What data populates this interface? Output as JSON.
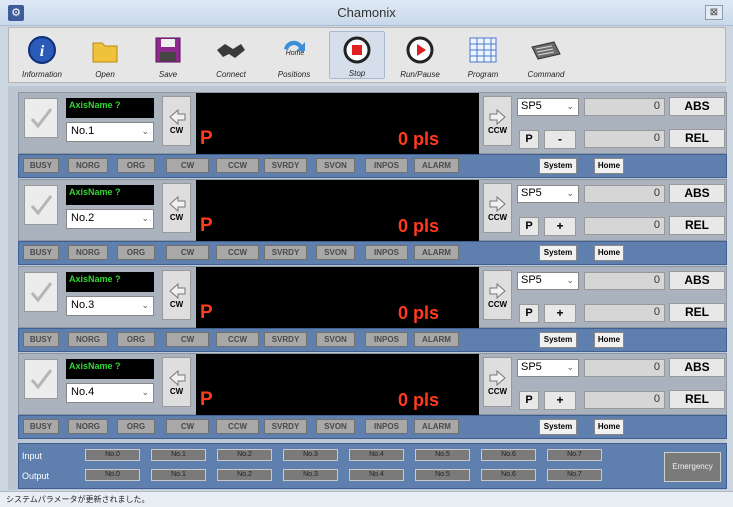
{
  "window": {
    "title": "Chamonix",
    "close_label": "⊠"
  },
  "toolbar": [
    {
      "label": "Information",
      "icon": "info-icon"
    },
    {
      "label": "Open",
      "icon": "folder-open-icon"
    },
    {
      "label": "Save",
      "icon": "floppy-disk-icon"
    },
    {
      "label": "Connect",
      "icon": "handshake-icon"
    },
    {
      "label": "Positions",
      "icon": "refresh-arrows-icon",
      "badge": "Home"
    },
    {
      "label": "Stop",
      "icon": "stop-icon"
    },
    {
      "label": "Run/Pause",
      "icon": "play-icon"
    },
    {
      "label": "Program",
      "icon": "grid-table-icon"
    },
    {
      "label": "Command",
      "icon": "keyboard-icon"
    }
  ],
  "axes": [
    {
      "name": "AxisName ?",
      "axis": "No.1",
      "position_label": "P",
      "position": "0 pls",
      "speed": "SP5",
      "abs_value": "0",
      "rel_value": "0",
      "direction": "-"
    },
    {
      "name": "AxisName ?",
      "axis": "No.2",
      "position_label": "P",
      "position": "0 pls",
      "speed": "SP5",
      "abs_value": "0",
      "rel_value": "0",
      "direction": "+"
    },
    {
      "name": "AxisName ?",
      "axis": "No.3",
      "position_label": "P",
      "position": "0 pls",
      "speed": "SP5",
      "abs_value": "0",
      "rel_value": "0",
      "direction": "+"
    },
    {
      "name": "AxisName ?",
      "axis": "No.4",
      "position_label": "P",
      "position": "0 pls",
      "speed": "SP5",
      "abs_value": "0",
      "rel_value": "0",
      "direction": "+"
    }
  ],
  "labels": {
    "cw": "CW",
    "ccw": "CCW",
    "abs": "ABS",
    "rel": "REL",
    "p": "P",
    "system": "System",
    "home": "Home"
  },
  "status_flags": [
    "BUSY",
    "NORG",
    "ORG",
    "CW",
    "CCW",
    "SVRDY",
    "SVON",
    "INPOS",
    "ALARM"
  ],
  "io": {
    "input_label": "Input",
    "output_label": "Output",
    "bits": [
      "No.0",
      "No.1",
      "No.2",
      "No.3",
      "No.4",
      "No.5",
      "No.6",
      "No.7"
    ],
    "emergency": "Emergency"
  },
  "statusbar": {
    "message": "システムパラメータが更新されました。"
  }
}
